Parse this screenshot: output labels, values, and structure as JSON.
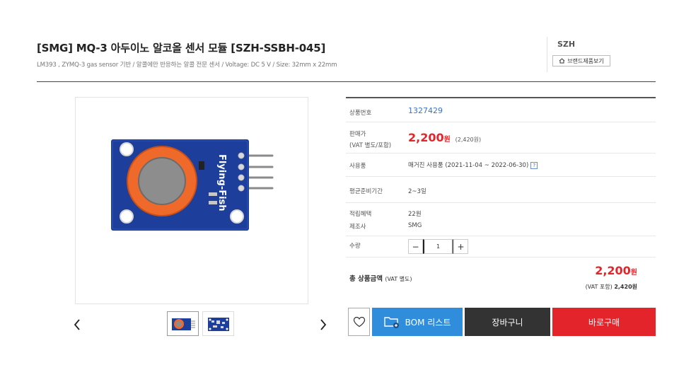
{
  "product": {
    "title": "[SMG] MQ-3 아두이노 알코올 센서 모듈 [SZH-SSBH-045]",
    "subtitle": "LM393 , ZYMQ-3 gas sensor 기반 / 알콜에만 반응하는 알콜 전문 센서 / Voltage: DC 5 V / Size: 32mm x 22mm"
  },
  "brand": {
    "name": "SZH",
    "button_label": "브랜드제품보기"
  },
  "gallery": {
    "module_text": "Flying-Fish",
    "prev_icon": "chevron-left-icon",
    "next_icon": "chevron-right-icon"
  },
  "info": {
    "product_no_label": "상품번호",
    "product_no": "1327429",
    "price_label_1": "판매가",
    "price_label_2": "(VAT 별도/포함)",
    "price": "2,200",
    "price_unit": "원",
    "price_vat": "(2,420원)",
    "usage_label": "사용품",
    "usage_value": "매거진 사용품 (2021-11-04 ~ 2022-06-30)",
    "usage_help": "?",
    "prep_label": "평균준비기간",
    "prep_value": "2~3일",
    "points_label": "적립혜택",
    "points_value": "22원",
    "maker_label": "제조사",
    "maker_value": "SMG",
    "qty_label": "수량",
    "qty_value": "1",
    "qty_minus": "−",
    "qty_plus": "+"
  },
  "total": {
    "label": "총 상품금액",
    "label_vat": "(VAT 별도)",
    "price": "2,200",
    "price_unit": "원",
    "vat_text": "(VAT 포함)",
    "vat_price": "2,420원"
  },
  "actions": {
    "bom_label": "BOM 리스트",
    "cart_label": "장바구니",
    "buy_label": "바로구매"
  },
  "colors": {
    "accent_red": "#e3242b",
    "bom_blue": "#2f8ddb",
    "cart_dark": "#333333",
    "link_blue": "#3a74c4"
  }
}
